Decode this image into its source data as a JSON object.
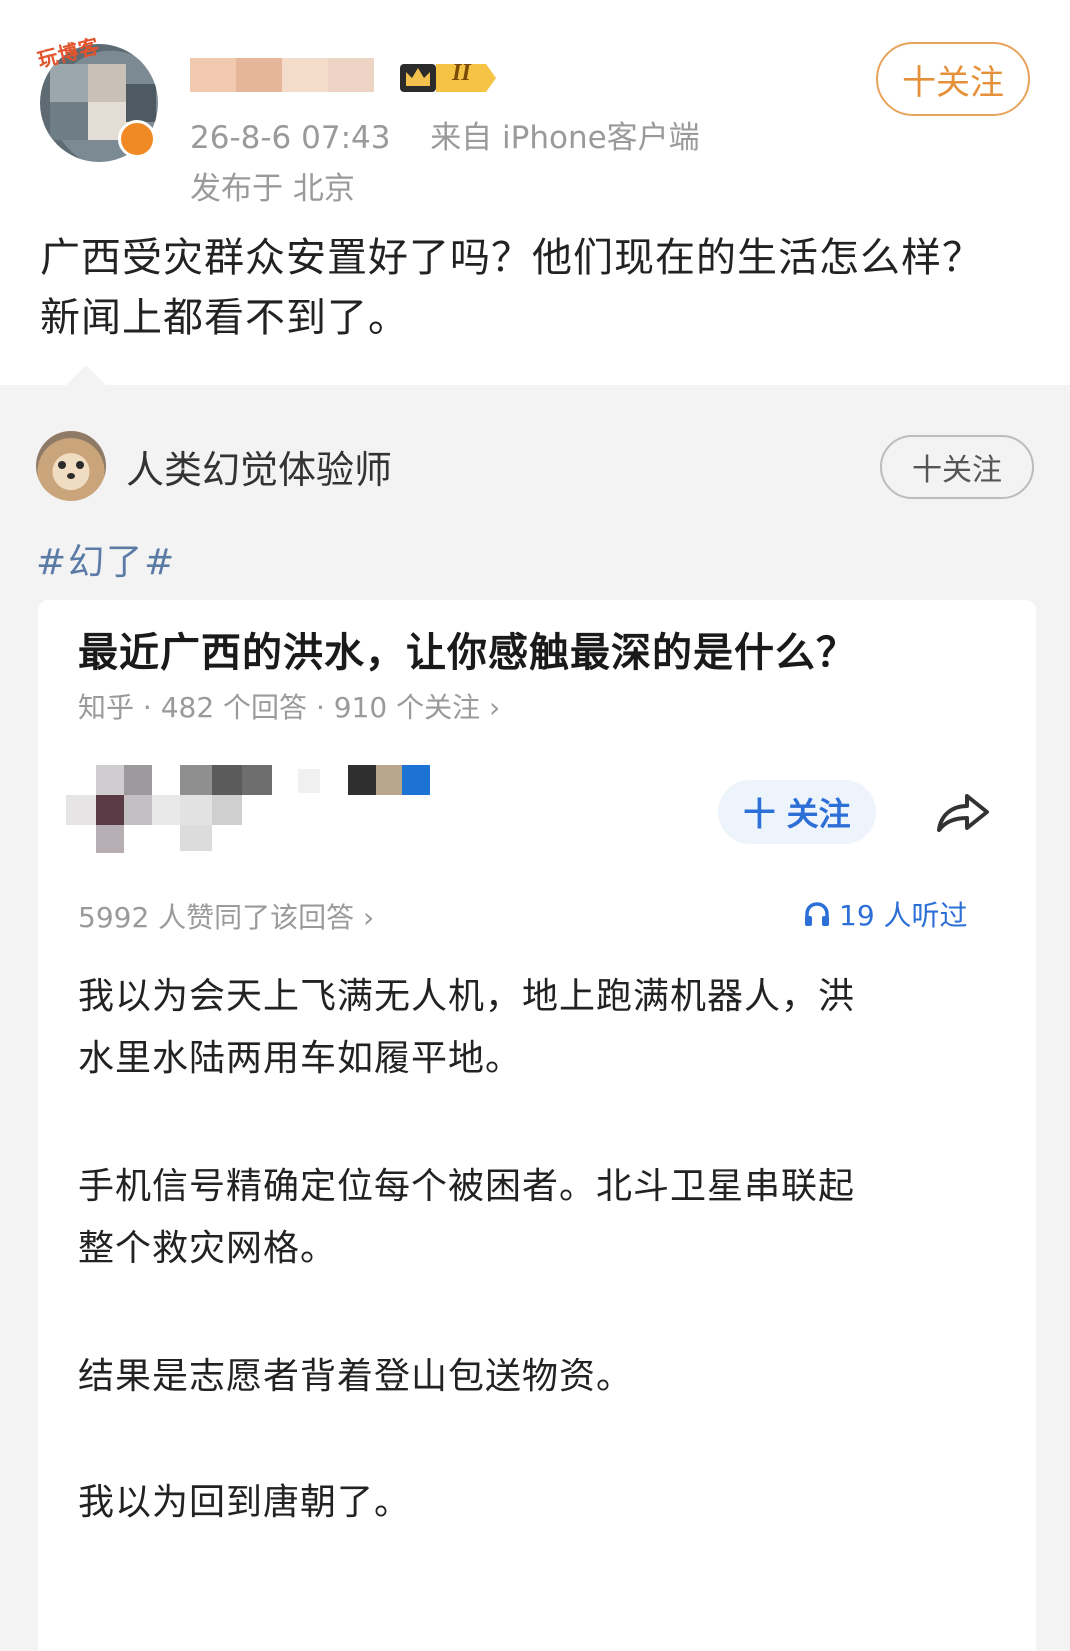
{
  "post": {
    "avatar_tag": "玩博客",
    "level_badge": "II",
    "time": "26-8-6 07:43",
    "source": "来自 iPhone客户端",
    "location": "发布于 北京",
    "follow_label": "十关注",
    "text_line1": "广西受灾群众安置好了吗？他们现在的生活怎么样？",
    "text_line2": "新闻上都看不到了。"
  },
  "repost": {
    "user_name": "人类幻觉体验师",
    "follow_label": "十关注",
    "hashtag": "#幻了#"
  },
  "zhihu_card": {
    "question_title": "最近广西的洪水，让你感触最深的是什么？",
    "question_meta": "知乎 · 482 个回答 · 910 个关注 ›",
    "follow_label": "十 关注",
    "agree_text": "5992 人赞同了该回答 ›",
    "listened_text": "19 人听过",
    "answer": [
      {
        "line1": "我以为会天上飞满无人机，地上跑满机器人，洪",
        "line2": "水里水陆两用车如履平地。"
      },
      {
        "line1": "手机信号精确定位每个被困者。北斗卫星串联起",
        "line2": "整个救灾网格。"
      },
      {
        "line1": "结果是志愿者背着登山包送物资。"
      },
      {
        "line1": "我以为回到唐朝了。"
      }
    ]
  },
  "icons": {
    "share": "share-arrow-icon",
    "headphones": "headphones-icon",
    "crown": "crown-icon",
    "verified": "verified-badge-icon"
  },
  "colors": {
    "follow_orange": "#e59139",
    "zhihu_blue": "#2c6fd6",
    "hashtag_blue": "#5b7ba6",
    "repost_bg": "#f3f3f3"
  }
}
